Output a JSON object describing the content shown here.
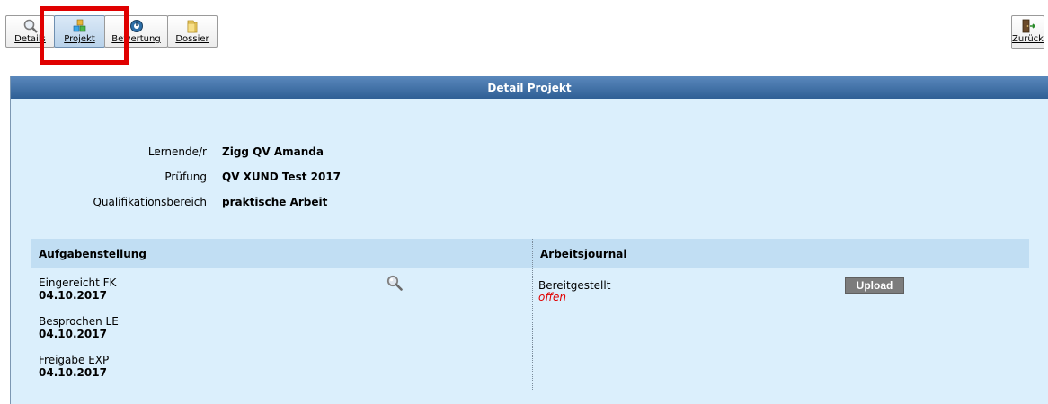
{
  "toolbar": {
    "details_label": "Details",
    "projekt_label": "Projekt",
    "bewertung_label": "Bewertung",
    "dossier_label": "Dossier"
  },
  "back_label": "Zurück",
  "panel": {
    "title": "Detail Projekt",
    "info": [
      {
        "label": "Lernende/r",
        "value": "Zigg QV Amanda"
      },
      {
        "label": "Prüfung",
        "value": "QV XUND Test 2017"
      },
      {
        "label": "Qualifikationsbereich",
        "value": "praktische Arbeit"
      }
    ]
  },
  "aufgabenstellung": {
    "title": "Aufgabenstellung",
    "entries": [
      {
        "label": "Eingereicht FK",
        "date": "04.10.2017"
      },
      {
        "label": "Besprochen LE",
        "date": "04.10.2017"
      },
      {
        "label": "Freigabe EXP",
        "date": "04.10.2017"
      }
    ]
  },
  "arbeitsjournal": {
    "title": "Arbeitsjournal",
    "label": "Bereitgestellt",
    "status": "offen",
    "upload_label": "Upload"
  },
  "colors": {
    "header_bg": "#2f5f95",
    "panel_bg": "#dbeffc",
    "section_bg": "#c1def3",
    "highlight": "#e00000",
    "status_color": "#e00000"
  },
  "icons": [
    "magnifier-icon",
    "cubes-icon",
    "gauge-icon",
    "folder-icon",
    "exit-door-icon"
  ]
}
